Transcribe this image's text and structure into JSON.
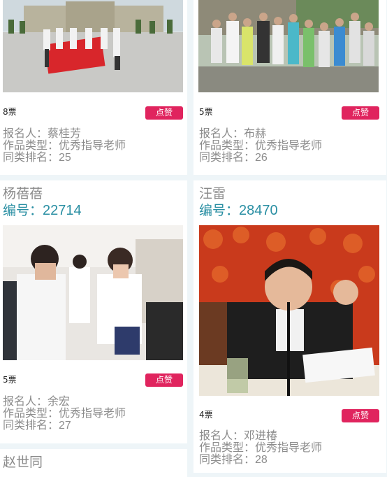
{
  "labels": {
    "vote_suffix": "票",
    "like_button": "点赞",
    "applicant_label": "报名人：",
    "category_label": "作品类型：",
    "rank_label": "同类排名："
  },
  "cards": [
    {
      "votes": "8票",
      "applicant": "蔡桂芳",
      "category": "优秀指导老师",
      "rank": "25"
    },
    {
      "votes": "5票",
      "applicant": "布赫",
      "category": "优秀指导老师",
      "rank": "26"
    },
    {
      "name": "杨蓓蓓",
      "number_label": "编号：",
      "number": "22714",
      "votes": "5票",
      "applicant": "余宏",
      "category": "优秀指导老师",
      "rank": "27"
    },
    {
      "name": "汪雷",
      "number_label": "编号：",
      "number": "28470",
      "votes": "4票",
      "applicant": "邓进椿",
      "category": "优秀指导老师",
      "rank": "28"
    },
    {
      "name": "赵世同"
    }
  ],
  "colors": {
    "accent_button": "#e0245e",
    "number_text": "#2a8fa3",
    "muted_text": "#8c8c8c",
    "page_bg": "#eef5f8"
  }
}
